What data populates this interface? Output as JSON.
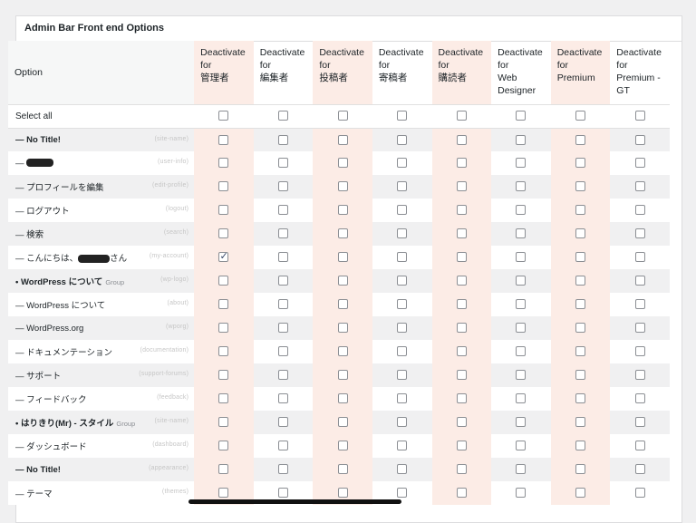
{
  "panel": {
    "title": "Admin Bar Front end Options"
  },
  "table": {
    "option_header": "Option",
    "role_headers": [
      "Deactivate\nfor\n管理者",
      "Deactivate\nfor\n編集者",
      "Deactivate\nfor\n投稿者",
      "Deactivate\nfor\n寄稿者",
      "Deactivate\nfor\n購読者",
      "Deactivate\nfor\nWeb\nDesigner",
      "Deactivate\nfor\nPremium",
      "Deactivate\nfor\nPremium -\nGT"
    ],
    "select_all_label": "Select all",
    "rows": [
      {
        "label": "— No Title!",
        "slug": "(site-name)",
        "bold": true,
        "group": "",
        "checked": []
      },
      {
        "label": "— ",
        "slug": "(user-info)",
        "bold": false,
        "group": "",
        "redact": true,
        "checked": []
      },
      {
        "label": "— プロフィールを編集",
        "slug": "(edit-profile)",
        "bold": false,
        "group": "",
        "checked": []
      },
      {
        "label": "— ログアウト",
        "slug": "(logout)",
        "bold": false,
        "group": "",
        "checked": []
      },
      {
        "label": "— 検索",
        "slug": "(search)",
        "bold": false,
        "group": "",
        "checked": []
      },
      {
        "label": "— こんにちは、",
        "label_suffix": "さん",
        "slug": "(my-account)",
        "bold": false,
        "group": "",
        "redact": true,
        "checked": [
          0
        ]
      },
      {
        "label": "• WordPress について",
        "slug": "(wp-logo)",
        "bold": true,
        "group": "Group",
        "checked": []
      },
      {
        "label": "— WordPress について",
        "slug": "(about)",
        "bold": false,
        "group": "",
        "checked": []
      },
      {
        "label": "— WordPress.org",
        "slug": "(wporg)",
        "bold": false,
        "group": "",
        "checked": []
      },
      {
        "label": "— ドキュメンテーション",
        "slug": "(documentation)",
        "bold": false,
        "group": "",
        "checked": []
      },
      {
        "label": "— サポート",
        "slug": "(support-forums)",
        "bold": false,
        "group": "",
        "checked": []
      },
      {
        "label": "— フィードバック",
        "slug": "(feedback)",
        "bold": false,
        "group": "",
        "checked": []
      },
      {
        "label": "• はりきり(Mr) - スタイル",
        "slug": "(site-name)",
        "bold": true,
        "group": "Group",
        "checked": []
      },
      {
        "label": "— ダッシュボード",
        "slug": "(dashboard)",
        "bold": false,
        "group": "",
        "checked": []
      },
      {
        "label": "— No Title!",
        "slug": "(appearance)",
        "bold": true,
        "group": "",
        "checked": []
      },
      {
        "label": "— テーマ",
        "slug": "(themes)",
        "bold": false,
        "group": "",
        "checked": []
      }
    ]
  }
}
